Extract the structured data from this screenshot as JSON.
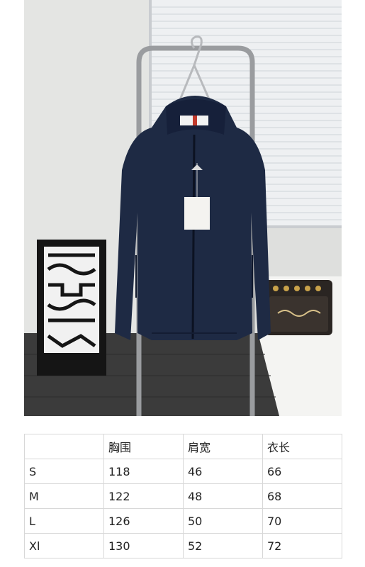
{
  "table": {
    "headers": [
      "",
      "胸围",
      "肩宽",
      "衣长"
    ],
    "rows": [
      [
        "S",
        "118",
        "46",
        "66"
      ],
      [
        "M",
        "122",
        "48",
        "68"
      ],
      [
        "L",
        "126",
        "50",
        "70"
      ],
      [
        "Xl",
        "130",
        "52",
        "72"
      ]
    ]
  },
  "colors": {
    "jacket": "#1e2a44",
    "wall": "#e6e6e4",
    "blinds": "#f2f3f5",
    "floor": "#3a3a3a"
  },
  "icons": [
    "hanger-icon"
  ]
}
